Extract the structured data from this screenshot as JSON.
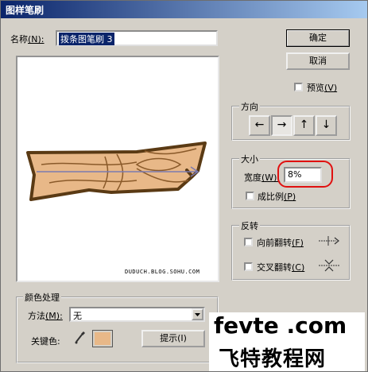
{
  "window": {
    "title": "图样笔刷"
  },
  "name_field": {
    "label_text": "名称",
    "hotkey": "(N):",
    "value": "拨条图笔刷 3"
  },
  "buttons": {
    "ok": "确定",
    "cancel": "取消",
    "hint": "提示(I)"
  },
  "preview": {
    "label": "预览",
    "hotkey": "(V)",
    "checked": false,
    "caption": "DUDUCH.BLOG.SOHU.COM"
  },
  "direction": {
    "title": "方向",
    "buttons": [
      {
        "glyph": "←",
        "selected": false
      },
      {
        "glyph": "→",
        "selected": true
      },
      {
        "glyph": "↑",
        "selected": false
      },
      {
        "glyph": "↓",
        "selected": false
      }
    ]
  },
  "size": {
    "title": "大小",
    "width_label": "宽度",
    "width_hotkey": "(W):",
    "width_value": "8%",
    "proportional_label": "成比例",
    "proportional_hotkey": "(P)",
    "proportional_checked": false,
    "highlight_color": "#e01010"
  },
  "flip": {
    "title": "反转",
    "along_label": "向前翻转",
    "along_hotkey": "(F)",
    "across_label": "交叉翻转",
    "across_hotkey": "(C)"
  },
  "colorization": {
    "title": "颜色处理",
    "method_label": "方法",
    "method_hotkey": "(M):",
    "method_value": "无",
    "key_color_label": "关键色:",
    "key_color": "#e8b888"
  },
  "watermark": {
    "line1": "fevte .com",
    "line2": "飞特教程网"
  }
}
